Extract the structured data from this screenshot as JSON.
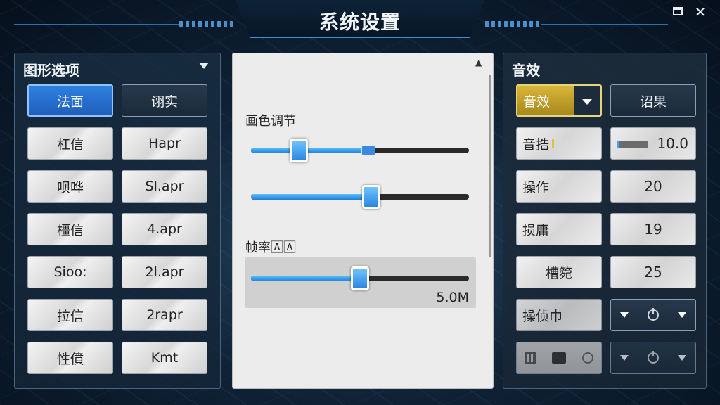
{
  "window": {
    "title": "系统设置"
  },
  "left_panel": {
    "header": "图形选项",
    "buttons": [
      {
        "label": "法面",
        "style": "active"
      },
      {
        "label": "诩实",
        "style": "dark"
      },
      {
        "label": "杠信",
        "style": "light"
      },
      {
        "label": "Hapr",
        "style": "light"
      },
      {
        "label": "呗哗",
        "style": "light"
      },
      {
        "label": "Sl.apr",
        "style": "light"
      },
      {
        "label": "橿信",
        "style": "light"
      },
      {
        "label": "4.apr",
        "style": "light"
      },
      {
        "label": "Sioo:",
        "style": "light"
      },
      {
        "label": "2l.apr",
        "style": "light"
      },
      {
        "label": "拉信",
        "style": "light"
      },
      {
        "label": "2rapr",
        "style": "light"
      },
      {
        "label": "性僨",
        "style": "light"
      },
      {
        "label": "Kmt",
        "style": "light"
      }
    ]
  },
  "middle_panel": {
    "section1_label": "画色调节",
    "slider1": {
      "value": 0.22,
      "marker": 0.54
    },
    "slider2": {
      "value": 0.55
    },
    "section2_label": "帧率🄰🄰",
    "slider3": {
      "value": 0.5
    },
    "fps_value": "5.0M"
  },
  "right_panel": {
    "header": "音效",
    "top_select": {
      "label": "音效"
    },
    "top_button": "诏果",
    "rows": [
      {
        "label": "音捁",
        "value": "10.0",
        "meter": 0.08
      },
      {
        "label": "操作",
        "value": "20"
      },
      {
        "label": "损庸",
        "value": "19"
      },
      {
        "label": "槽箢",
        "value": "25"
      }
    ],
    "select_row_label": "操侦巾"
  }
}
